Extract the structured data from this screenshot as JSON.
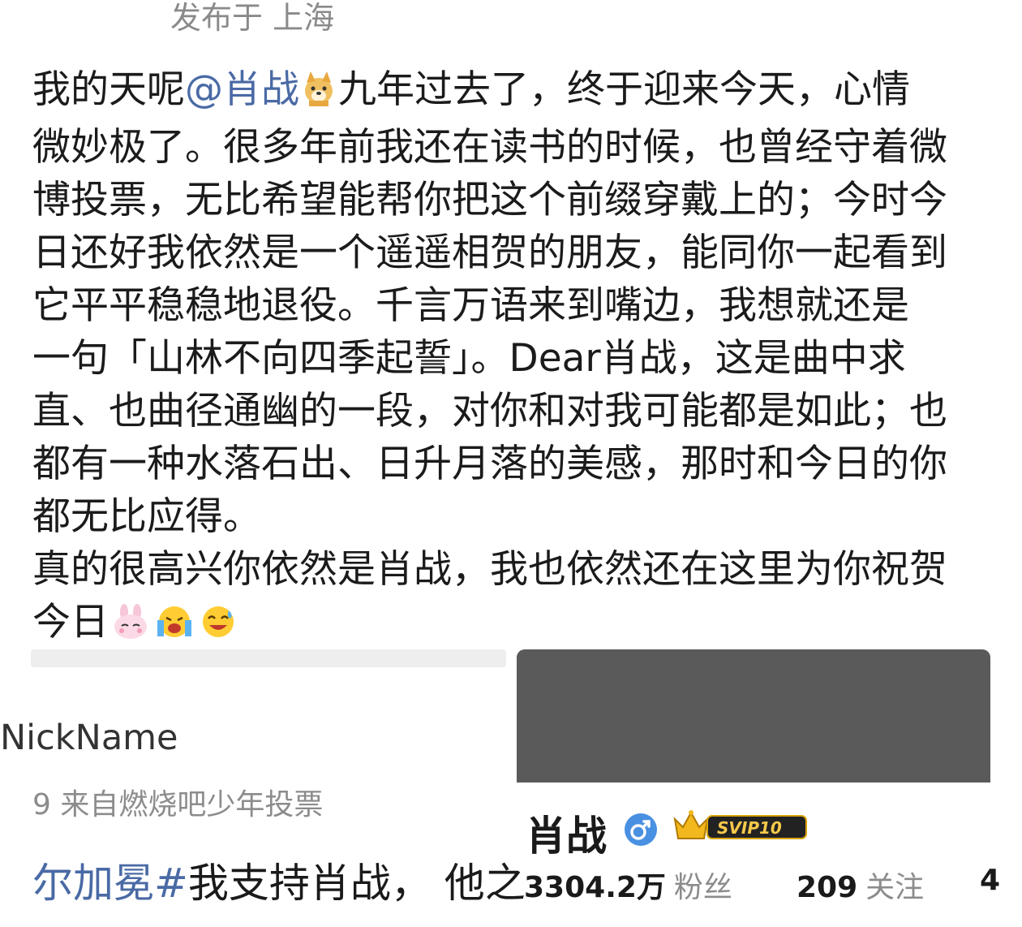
{
  "post": {
    "location": "发布于 上海",
    "lines": [
      {
        "pre": "我的天呢",
        "mention": "@肖战",
        "post": "九年过去了，终于迎来今天，心情"
      },
      {
        "text": "微妙极了。很多年前我还在读书的时候，也曾经守着微"
      },
      {
        "text": "博投票，无比希望能帮你把这个前缀穿戴上的；今时今"
      },
      {
        "text": "日还好我依然是一个遥遥相贺的朋友，能同你一起看到"
      },
      {
        "text": "它平平稳稳地退役。千言万语来到嘴边，我想就还是"
      },
      {
        "text": "一句「山林不向四季起誓」。Dear肖战，这是曲中求"
      },
      {
        "text": "直、也曲径通幽的一段，对你和对我可能都是如此；也"
      },
      {
        "text": "都有一种水落石出、日升月落的美感，那时和今日的你"
      },
      {
        "text": "都无比应得。"
      },
      {
        "text": "真的很高兴你依然是肖战，我也依然还在这里为你祝贺"
      },
      {
        "text": "今日"
      }
    ],
    "emojis": [
      "dog-emoji",
      "bunny-emoji",
      "crying-emoji",
      "laugh-tear-emoji"
    ]
  },
  "quote_card": {
    "nickname": "NickName",
    "source": "9  来自燃烧吧少年投票",
    "topic_prefix": "尔加冕",
    "topic_hash": "#",
    "topic_text": "我支持肖战， 他",
    "topic_cut": "之"
  },
  "profile_card": {
    "name": "肖战",
    "vip_label": "SVIP10",
    "followers_num": "3304.2万",
    "followers_label": "粉丝",
    "following_num": "209",
    "following_label": "关注",
    "cut_digit": "4",
    "accent": "#4a90e2"
  }
}
